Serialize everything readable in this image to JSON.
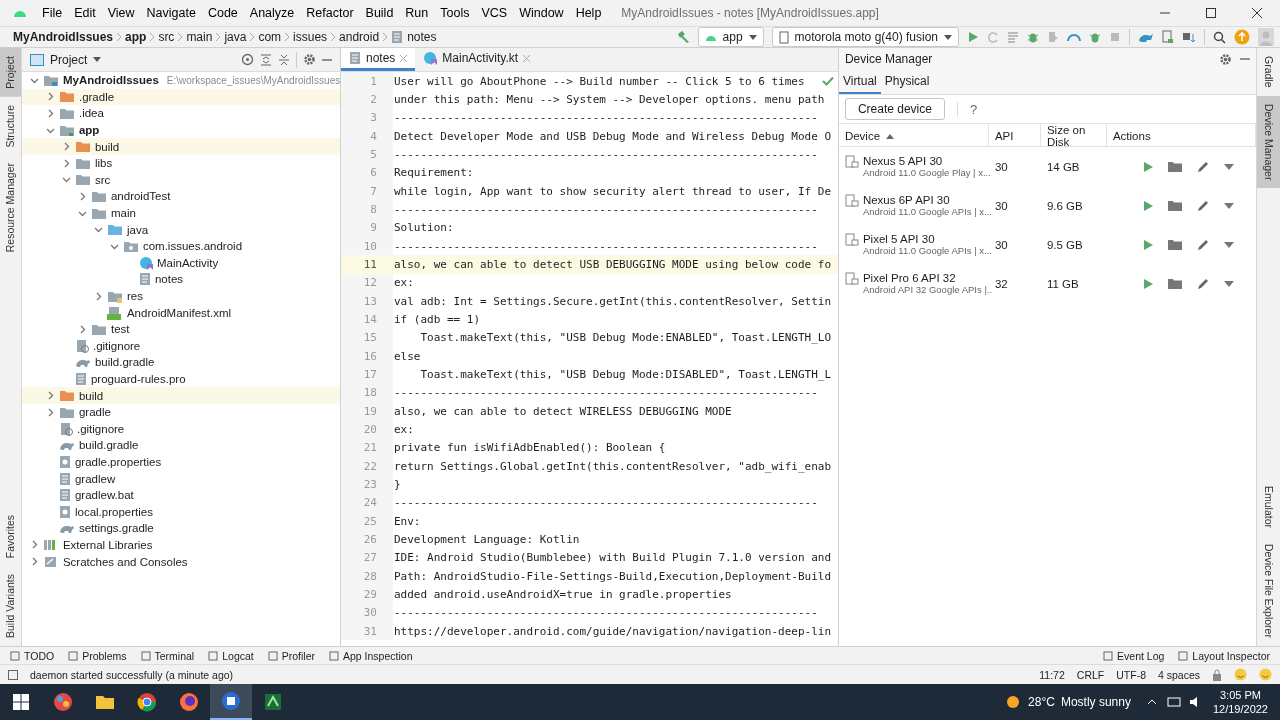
{
  "window": {
    "title": "MyAndroidIssues - notes [MyAndroidIssues.app]"
  },
  "menu": [
    "File",
    "Edit",
    "View",
    "Navigate",
    "Code",
    "Analyze",
    "Refactor",
    "Build",
    "Run",
    "Tools",
    "VCS",
    "Window",
    "Help"
  ],
  "breadcrumb": [
    {
      "label": "MyAndroidIssues",
      "bold": true
    },
    {
      "label": "app",
      "bold": true
    },
    {
      "label": "src",
      "bold": false
    },
    {
      "label": "main",
      "bold": false
    },
    {
      "label": "java",
      "bold": false
    },
    {
      "label": "com",
      "bold": false
    },
    {
      "label": "issues",
      "bold": false
    },
    {
      "label": "android",
      "bold": false
    },
    {
      "label": "notes",
      "bold": false,
      "file": true
    }
  ],
  "toolbar": {
    "config": "app",
    "device": "motorola moto g(40) fusion"
  },
  "left_stripe": {
    "top": [
      {
        "label": "Project",
        "selected": true
      },
      {
        "label": "Structure",
        "selected": false
      },
      {
        "label": "Resource Manager",
        "selected": false
      }
    ],
    "bottom": [
      {
        "label": "Favorites",
        "selected": false
      },
      {
        "label": "Build Variants",
        "selected": false
      }
    ]
  },
  "project": {
    "title": "Project",
    "tree": [
      {
        "label": "MyAndroidIssues",
        "kind": "project",
        "path": "E:\\workspace_issues\\MyAndroidIssues",
        "expanded": true,
        "children": [
          {
            "label": ".gradle",
            "kind": "excluded",
            "expanded": false
          },
          {
            "label": ".idea",
            "kind": "folder",
            "expanded": false
          },
          {
            "label": "app",
            "kind": "module",
            "expanded": true,
            "children": [
              {
                "label": "build",
                "kind": "excluded",
                "expanded": false
              },
              {
                "label": "libs",
                "kind": "folder",
                "expanded": false
              },
              {
                "label": "src",
                "kind": "folder",
                "expanded": true,
                "children": [
                  {
                    "label": "androidTest",
                    "kind": "folder",
                    "expanded": false
                  },
                  {
                    "label": "main",
                    "kind": "folder",
                    "expanded": true,
                    "children": [
                      {
                        "label": "java",
                        "kind": "source",
                        "expanded": true,
                        "children": [
                          {
                            "label": "com.issues.android",
                            "kind": "package",
                            "expanded": true,
                            "children": [
                              {
                                "label": "MainActivity",
                                "kind": "kotlin"
                              },
                              {
                                "label": "notes",
                                "kind": "text"
                              }
                            ]
                          }
                        ]
                      },
                      {
                        "label": "res",
                        "kind": "res",
                        "expanded": false
                      },
                      {
                        "label": "AndroidManifest.xml",
                        "kind": "manifest"
                      }
                    ]
                  },
                  {
                    "label": "test",
                    "kind": "folder",
                    "expanded": false
                  }
                ]
              },
              {
                "label": ".gitignore",
                "kind": "gitignore"
              },
              {
                "label": "build.gradle",
                "kind": "gradle"
              },
              {
                "label": "proguard-rules.pro",
                "kind": "text"
              }
            ]
          },
          {
            "label": "build",
            "kind": "excluded",
            "expanded": false
          },
          {
            "label": "gradle",
            "kind": "folder",
            "expanded": false
          },
          {
            "label": ".gitignore",
            "kind": "gitignore"
          },
          {
            "label": "build.gradle",
            "kind": "gradle"
          },
          {
            "label": "gradle.properties",
            "kind": "properties"
          },
          {
            "label": "gradlew",
            "kind": "text"
          },
          {
            "label": "gradlew.bat",
            "kind": "text"
          },
          {
            "label": "local.properties",
            "kind": "properties"
          },
          {
            "label": "settings.gradle",
            "kind": "gradle"
          }
        ]
      },
      {
        "label": "External Libraries",
        "kind": "library",
        "expanded": false
      },
      {
        "label": "Scratches and Consoles",
        "kind": "scratch",
        "expanded": false
      }
    ]
  },
  "editor": {
    "tabs": [
      {
        "label": "notes",
        "kind": "text",
        "selected": true
      },
      {
        "label": "MainActivity.kt",
        "kind": "kotlin",
        "selected": false
      }
    ],
    "lines": [
      {
        "n": "1",
        "text": "User will go AboutPhone --> Build number -- Click 5 to 6 times",
        "current": false
      },
      {
        "n": "2",
        "text": "under this path: Menu --> System --> Developer options. menu path",
        "current": false
      },
      {
        "n": "3",
        "text": "----------------------------------------------------------------",
        "current": false
      },
      {
        "n": "4",
        "text": "Detect Developer Mode and USB Debug Mode and Wireless Debug Mode O",
        "current": false
      },
      {
        "n": "5",
        "text": "----------------------------------------------------------------",
        "current": false
      },
      {
        "n": "6",
        "text": "Requirement:",
        "current": false
      },
      {
        "n": "7",
        "text": "while login, App want to show security alert thread to user, If De",
        "current": false
      },
      {
        "n": "8",
        "text": "----------------------------------------------------------------",
        "current": false
      },
      {
        "n": "9",
        "text": "Solution:",
        "current": false
      },
      {
        "n": "10",
        "text": "----------------------------------------------------------------",
        "current": false
      },
      {
        "n": "11",
        "text": "also, we can able to detect USB DEBUGGING MODE using below code fo",
        "current": true
      },
      {
        "n": "12",
        "text": "ex:",
        "current": false
      },
      {
        "n": "13",
        "text": "val adb: Int = Settings.Secure.getInt(this.contentResolver, Settin",
        "current": false
      },
      {
        "n": "14",
        "text": "if (adb == 1)",
        "current": false
      },
      {
        "n": "15",
        "text": "    Toast.makeText(this, \"USB Debug Mode:ENABLED\", Toast.LENGTH_LO",
        "current": false
      },
      {
        "n": "16",
        "text": "else",
        "current": false
      },
      {
        "n": "17",
        "text": "    Toast.makeText(this, \"USB Debug Mode:DISABLED\", Toast.LENGTH_L",
        "current": false
      },
      {
        "n": "18",
        "text": "----------------------------------------------------------------",
        "current": false
      },
      {
        "n": "19",
        "text": "also, we can able to detect WIRELESS DEBUGGING MODE",
        "current": false
      },
      {
        "n": "20",
        "text": "ex:",
        "current": false
      },
      {
        "n": "21",
        "text": "private fun isWifiAdbEnabled(): Boolean {",
        "current": false
      },
      {
        "n": "22",
        "text": "return Settings.Global.getInt(this.contentResolver, \"adb_wifi_enab",
        "current": false
      },
      {
        "n": "23",
        "text": "}",
        "current": false
      },
      {
        "n": "24",
        "text": "----------------------------------------------------------------",
        "current": false
      },
      {
        "n": "25",
        "text": "Env:",
        "current": false
      },
      {
        "n": "26",
        "text": "Development Language: Kotlin",
        "current": false
      },
      {
        "n": "27",
        "text": "IDE: Android Studio(Bumblebee) with Build Plugin 7.1.0 version and",
        "current": false
      },
      {
        "n": "28",
        "text": "Path: AndroidStudio-File-Settings-Build,Execution,Deployment-Build",
        "current": false
      },
      {
        "n": "29",
        "text": "added android.useAndroidX=true in gradle.properties",
        "current": false
      },
      {
        "n": "30",
        "text": "----------------------------------------------------------------",
        "current": false
      },
      {
        "n": "31",
        "text": "https://developer.android.com/guide/navigation/navigation-deep-lin",
        "current": false
      }
    ]
  },
  "device_manager": {
    "title": "Device Manager",
    "tabs": [
      {
        "label": "Virtual",
        "selected": true
      },
      {
        "label": "Physical",
        "selected": false
      }
    ],
    "create_button": "Create device",
    "help": "?",
    "columns": [
      "Device",
      "API",
      "Size on Disk",
      "Actions"
    ],
    "rows": [
      {
        "name": "Nexus 5 API 30",
        "description": "Android 11.0 Google Play | x...",
        "api": "30",
        "size": "14 GB"
      },
      {
        "name": "Nexus 6P API 30",
        "description": "Android 11.0 Google APIs | x...",
        "api": "30",
        "size": "9.6 GB"
      },
      {
        "name": "Pixel 5 API 30",
        "description": "Android 11.0 Google APIs | x...",
        "api": "30",
        "size": "9.5 GB"
      },
      {
        "name": "Pixel Pro 6 API 32",
        "description": "Android API 32 Google APIs |..",
        "api": "32",
        "size": "11 GB"
      }
    ]
  },
  "right_stripe": {
    "top": [
      {
        "label": "Gradle",
        "selected": false
      },
      {
        "label": "Device Manager",
        "selected": true
      }
    ],
    "bottom": [
      {
        "label": "Emulator",
        "selected": false
      },
      {
        "label": "Device File Explorer",
        "selected": false
      }
    ]
  },
  "tool_windows": {
    "left": [
      "TODO",
      "Problems",
      "Terminal",
      "Logcat",
      "Profiler",
      "App Inspection"
    ],
    "right": [
      "Event Log",
      "Layout Inspector"
    ]
  },
  "status_bar": {
    "message": "daemon started successfully (a minute ago)",
    "items": [
      "11:72",
      "CRLF",
      "UTF-8",
      "4 spaces"
    ]
  },
  "taskbar": {
    "apps": [
      {
        "selected": false
      },
      {
        "selected": false
      },
      {
        "selected": false
      },
      {
        "selected": false
      },
      {
        "selected": true
      },
      {
        "selected": false
      }
    ],
    "weather": "28°C",
    "weather_text": "Mostly sunny",
    "time": "3:05 PM",
    "date": "12/19/2022"
  }
}
